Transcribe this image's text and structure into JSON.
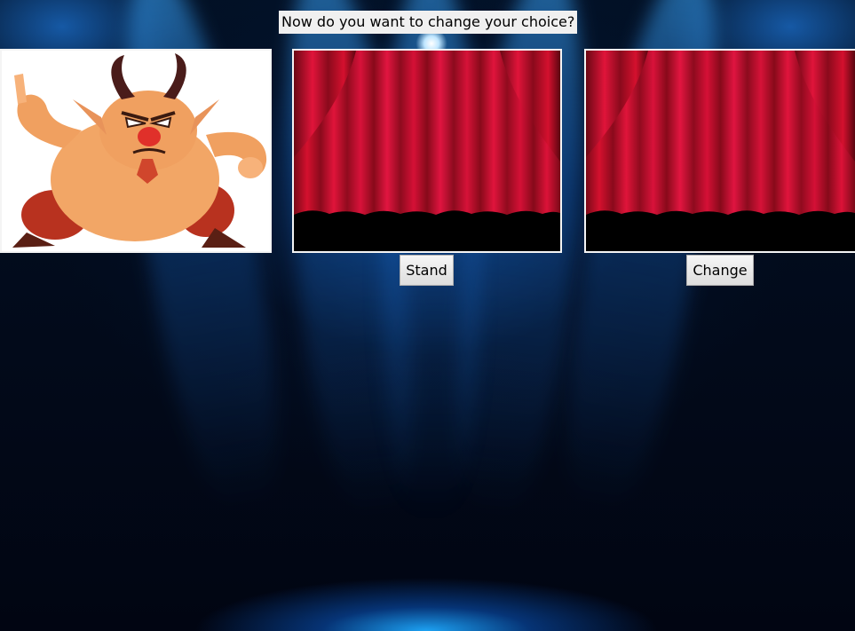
{
  "prompt": "Now do you want to change your choice?",
  "doors": [
    {
      "content": "goat-character",
      "state": "open"
    },
    {
      "content": "stage-curtain",
      "state": "closed"
    },
    {
      "content": "stage-curtain",
      "state": "closed"
    }
  ],
  "buttons": {
    "stand_label": "Stand",
    "change_label": "Change"
  },
  "colors": {
    "background": "#020617",
    "spotlight": "#3aa8ff",
    "curtain": "#c8102e",
    "label_bg": "#f0f0f0"
  }
}
